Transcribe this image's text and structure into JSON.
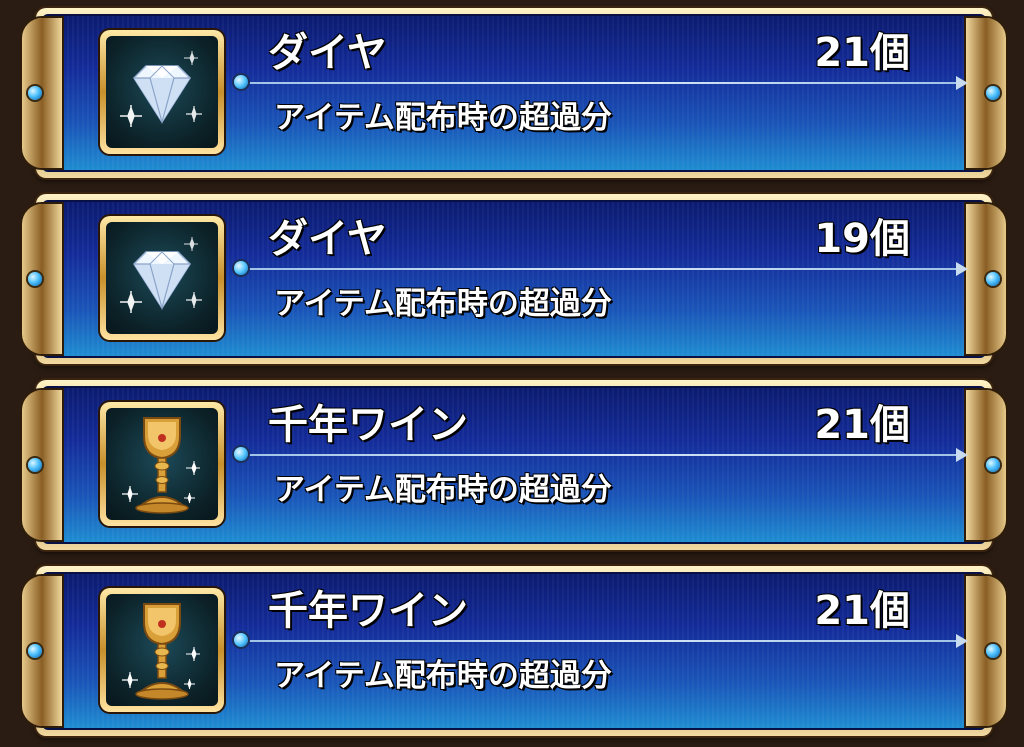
{
  "items": [
    {
      "name": "ダイヤ",
      "quantity": "21個",
      "description": "アイテム配布時の超過分",
      "icon": "diamond-icon"
    },
    {
      "name": "ダイヤ",
      "quantity": "19個",
      "description": "アイテム配布時の超過分",
      "icon": "diamond-icon"
    },
    {
      "name": "千年ワイン",
      "quantity": "21個",
      "description": "アイテム配布時の超過分",
      "icon": "golden-goblet-icon"
    },
    {
      "name": "千年ワイン",
      "quantity": "21個",
      "description": "アイテム配布時の超過分",
      "icon": "golden-goblet-icon"
    }
  ],
  "colors": {
    "panel_top": "#0b1a6e",
    "panel_bottom": "#1f8fd2",
    "frame_gold": "#d8b26a",
    "text": "#ffffff"
  }
}
